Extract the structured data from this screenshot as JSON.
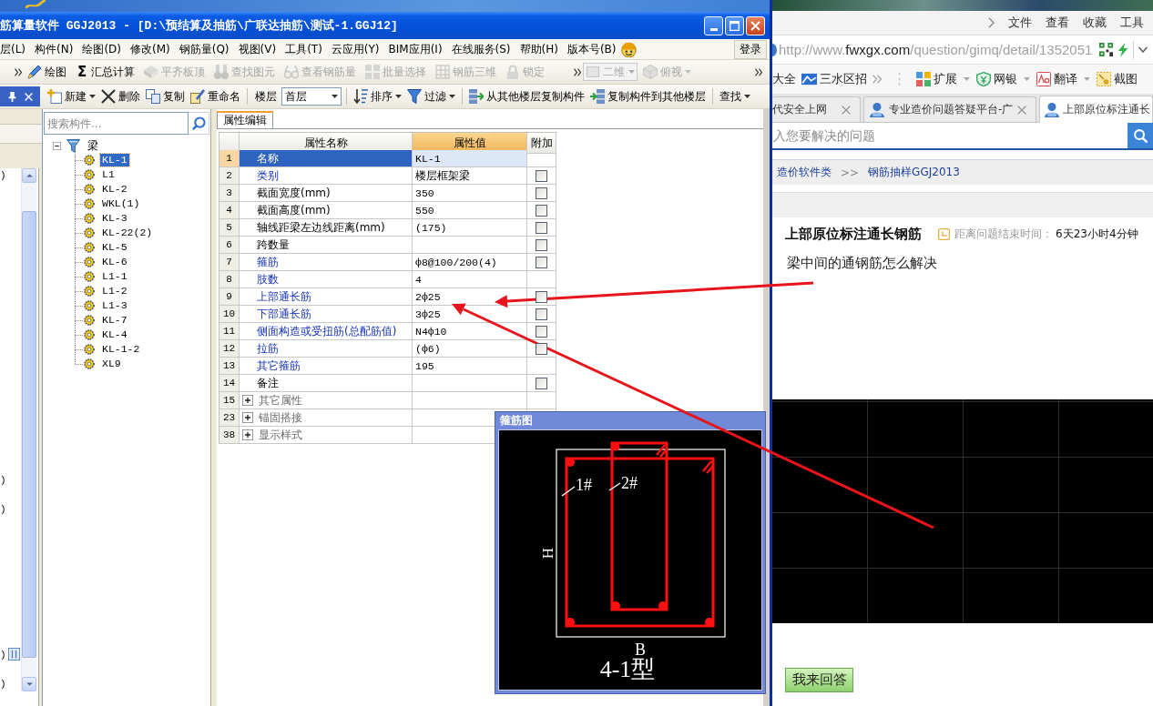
{
  "app_window": {
    "title": "筋算量软件 GGJ2013 - [D:\\预结算及抽筋\\广联达抽筋\\测试-1.GGJ12]",
    "menu": [
      "层(L)",
      "构件(N)",
      "绘图(D)",
      "修改(M)",
      "钢筋量(Q)",
      "视图(V)",
      "工具(T)",
      "云应用(Y)",
      "BIM应用(I)",
      "在线服务(S)",
      "帮助(H)",
      "版本号(B)"
    ],
    "login": "登录",
    "toolbar_1": {
      "items": [
        {
          "label": "绘图",
          "disabled": false
        },
        {
          "label": "汇总计算",
          "glyph": "Σ",
          "disabled": false
        },
        {
          "label": "平齐板顶",
          "disabled": true
        },
        {
          "label": "查找图元",
          "disabled": true
        },
        {
          "label": "查看钢筋量",
          "disabled": true
        },
        {
          "label": "批量选择",
          "disabled": true
        },
        {
          "label": "钢筋三维",
          "disabled": true
        },
        {
          "label": "锁定",
          "disabled": true
        }
      ],
      "view_select": {
        "value": "二维",
        "disabled": true
      },
      "view_button": {
        "label": "俯视",
        "disabled": true
      }
    },
    "toolbar_2": {
      "items": [
        {
          "kind": "menu",
          "label": "新建"
        },
        {
          "kind": "button",
          "label": "删除"
        },
        {
          "kind": "button",
          "label": "复制"
        },
        {
          "kind": "button",
          "label": "重命名"
        },
        {
          "kind": "label",
          "label": "楼层"
        },
        {
          "kind": "select",
          "label": "首层"
        },
        {
          "kind": "menu",
          "label": "排序"
        },
        {
          "kind": "menu",
          "label": "过滤"
        },
        {
          "kind": "button",
          "label": "从其他楼层复制构件"
        },
        {
          "kind": "button",
          "label": "复制构件到其他楼层"
        },
        {
          "kind": "menu",
          "label": "查找"
        }
      ]
    },
    "side_panel": {
      "fragments": [
        ")",
        ")",
        ")",
        ")",
        ")"
      ]
    },
    "component_panel": {
      "search": {
        "placeholder": "搜索构件..."
      },
      "tree": [
        {
          "label": "梁",
          "expanded": true,
          "children": [
            {
              "label": "KL-1",
              "selected": true
            },
            {
              "label": "L1",
              "selected": false
            },
            {
              "label": "KL-2",
              "selected": false
            },
            {
              "label": "WKL(1)",
              "selected": false
            },
            {
              "label": "KL-3",
              "selected": false
            },
            {
              "label": "KL-22(2)",
              "selected": false
            },
            {
              "label": "KL-5",
              "selected": false
            },
            {
              "label": "KL-6",
              "selected": false
            },
            {
              "label": "L1-1",
              "selected": false
            },
            {
              "label": "L1-2",
              "selected": false
            },
            {
              "label": "L1-3",
              "selected": false
            },
            {
              "label": "KL-7",
              "selected": false
            },
            {
              "label": "KL-4",
              "selected": false
            },
            {
              "label": "KL-1-2",
              "selected": false
            },
            {
              "label": "XL9",
              "selected": false
            }
          ]
        }
      ]
    },
    "properties": {
      "tab": "属性编辑",
      "columns": [
        {
          "label": "属性名称",
          "selected": false
        },
        {
          "label": "属性值",
          "selected": true
        },
        {
          "label": "附加",
          "selected": false
        }
      ],
      "rows": [
        {
          "index": "1",
          "kind": "plain",
          "name": "名称",
          "value": "KL-1",
          "public": false,
          "selected": true
        },
        {
          "index": "2",
          "kind": "option",
          "name": "类别",
          "value": "楼层框架梁",
          "public": true,
          "checked": false,
          "selected": false
        },
        {
          "index": "3",
          "kind": "option",
          "name": "截面宽度(mm)",
          "value": "350",
          "public": false,
          "checked": false,
          "selected": false
        },
        {
          "index": "4",
          "kind": "option",
          "name": "截面高度(mm)",
          "value": "550",
          "public": false,
          "checked": false,
          "selected": false
        },
        {
          "index": "5",
          "kind": "option",
          "name": "轴线距梁左边线距离(mm)",
          "value": "(175)",
          "public": false,
          "checked": false,
          "selected": false
        },
        {
          "index": "6",
          "kind": "option",
          "name": "跨数量",
          "public": false,
          "checked": false,
          "selected": false
        },
        {
          "index": "7",
          "kind": "option",
          "name": "箍筋",
          "value": "ф8@100/200(4)",
          "public": true,
          "checked": false,
          "selected": false
        },
        {
          "index": "8",
          "kind": "plain",
          "name": "肢数",
          "value": "4",
          "public": true,
          "selected": false
        },
        {
          "index": "9",
          "kind": "option",
          "name": "上部通长筋",
          "value": "2ф25",
          "public": true,
          "checked": false,
          "selected": false
        },
        {
          "index": "10",
          "kind": "option",
          "name": "下部通长筋",
          "value": "3ф25",
          "public": true,
          "checked": false,
          "selected": false
        },
        {
          "index": "11",
          "kind": "option",
          "name": "侧面构造或受扭筋(总配筋值)",
          "value": "N4ф10",
          "public": true,
          "checked": false,
          "selected": false
        },
        {
          "index": "12",
          "kind": "option",
          "name": "拉筋",
          "value": "(ф6)",
          "public": true,
          "checked": false,
          "selected": false
        },
        {
          "index": "13",
          "kind": "plain",
          "name": "其它箍筋",
          "value": "195",
          "public": true,
          "selected": false
        },
        {
          "index": "14",
          "kind": "option",
          "name": "备注",
          "public": false,
          "checked": false,
          "selected": false
        },
        {
          "index": "15",
          "kind": "group",
          "name": "其它属性",
          "expanded": false,
          "selected": false
        },
        {
          "index": "23",
          "kind": "group",
          "name": "锚固搭接",
          "expanded": false,
          "selected": false
        },
        {
          "index": "38",
          "kind": "group",
          "name": "显示样式",
          "expanded": false,
          "selected": false
        }
      ]
    },
    "stirrup_dialog": {
      "title": "箍筋图",
      "bar_labels": [
        "1#",
        "2#"
      ],
      "height_label": "H",
      "width_label": "B",
      "caption": "4-1型"
    }
  },
  "browser": {
    "menu": [
      "文件",
      "查看",
      "收藏",
      "工具"
    ],
    "address": "http://www.**fwxgx.com**/question/gimq/detail/1352051",
    "bookmarks": [
      {
        "label": "大全",
        "icon": false
      },
      {
        "label": "三水区招",
        "icon": true
      }
    ],
    "tools": [
      {
        "label": "扩展",
        "menu": true
      },
      {
        "label": "网银",
        "menu": true
      },
      {
        "label": "翻译",
        "menu": true
      },
      {
        "label": "截图",
        "menu": false
      }
    ],
    "tabs": [
      {
        "label": "代安全上网",
        "icon": false,
        "closable": true,
        "selected": false
      },
      {
        "label": "专业造价问题答疑平台-广",
        "icon": true,
        "closable": true,
        "selected": false
      },
      {
        "label": "上部原位标注通长",
        "icon": true,
        "closable": false,
        "selected": true
      }
    ],
    "search": {
      "placeholder": "入您要解决的问题"
    },
    "breadcrumb": [
      {
        "kind": "link",
        "label": "造价软件类"
      },
      {
        "kind": "separator",
        "label": ">>"
      },
      {
        "kind": "link",
        "label": "钢筋抽样GGJ2013"
      }
    ],
    "question": {
      "title": "上部原位标注通长钢筋",
      "deadline_label": "距离问题结束时间：",
      "deadline": "6天23小时4分钟",
      "body": "梁中间的通钢筋怎么解决"
    },
    "answer_button": "我来回答"
  }
}
